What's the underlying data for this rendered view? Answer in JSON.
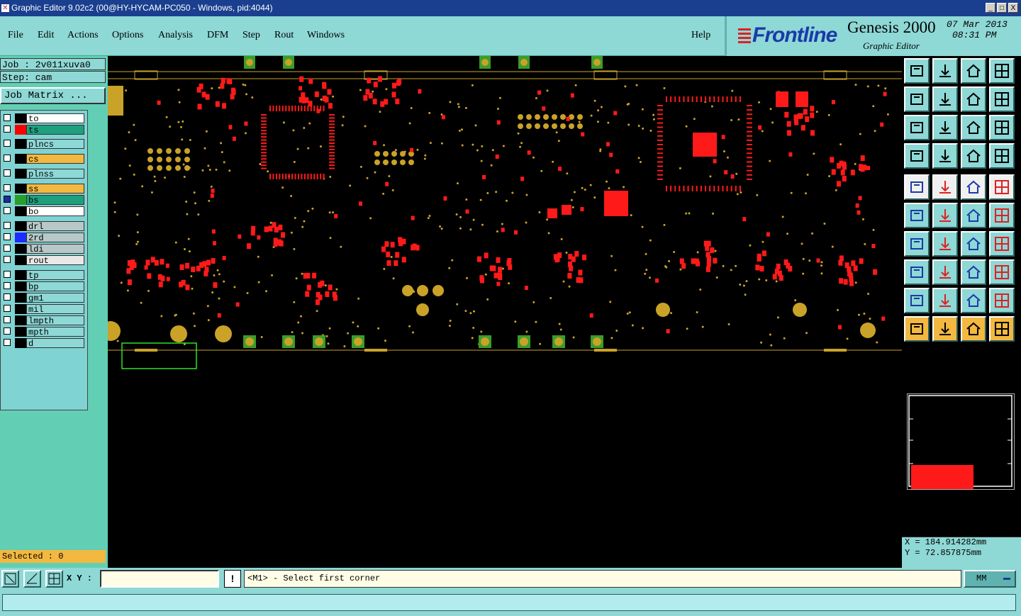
{
  "window": {
    "title": "Graphic Editor 9.02c2 (00@HY-HYCAM-PC050 - Windows, pid:4044)",
    "controls": [
      "_",
      "□",
      "X"
    ]
  },
  "menubar": {
    "items": [
      "File",
      "Edit",
      "Actions",
      "Options",
      "Analysis",
      "DFM",
      "Step",
      "Rout",
      "Windows"
    ],
    "help": "Help"
  },
  "brand": {
    "logo": "Frontline",
    "product": "Genesis 2000",
    "module": "Graphic Editor",
    "date": "07 Mar 2013",
    "time": "08:31 PM"
  },
  "job": {
    "job_line": "Job : 2v011xuva0",
    "step_line": "Step: cam",
    "matrix_button": "Job Matrix ..."
  },
  "layers": [
    {
      "name": "to",
      "color": "#ffffff",
      "swatch": "#000000",
      "selected": false
    },
    {
      "name": "ts",
      "color": "#1ea07d",
      "swatch": "#ff0000",
      "selected": false
    },
    {
      "name": "plncs",
      "color": "#8ed8d6",
      "swatch": "#000000",
      "selected": false
    },
    {
      "name": "cs",
      "color": "#f2b840",
      "swatch": "#000000",
      "selected": false
    },
    {
      "name": "plnss",
      "color": "#8ed8d6",
      "swatch": "#000000",
      "selected": false
    },
    {
      "name": "ss",
      "color": "#f2b840",
      "swatch": "#000000",
      "selected": false
    },
    {
      "name": "bs",
      "color": "#1ea07d",
      "swatch": "#2a9d2a",
      "selected": true
    },
    {
      "name": "bo",
      "color": "#ffffff",
      "swatch": "#000000",
      "selected": false
    },
    {
      "name": "drl",
      "color": "#b8c8c8",
      "swatch": "#000000",
      "selected": false
    },
    {
      "name": "2rd",
      "color": "#b8c8c8",
      "swatch": "#1b2cff",
      "selected": false
    },
    {
      "name": "ldi",
      "color": "#b8c8c8",
      "swatch": "#000000",
      "selected": false
    },
    {
      "name": "rout",
      "color": "#e8e8e8",
      "swatch": "#000000",
      "selected": false
    },
    {
      "name": "tp",
      "color": "#8ed8d6",
      "swatch": "#000000",
      "selected": false
    },
    {
      "name": "bp",
      "color": "#8ed8d6",
      "swatch": "#000000",
      "selected": false
    },
    {
      "name": "gm1",
      "color": "#8ed8d6",
      "swatch": "#000000",
      "selected": false
    },
    {
      "name": "mil",
      "color": "#8ed8d6",
      "swatch": "#000000",
      "selected": false
    },
    {
      "name": "lmpth",
      "color": "#8ed8d6",
      "swatch": "#000000",
      "selected": false
    },
    {
      "name": "mpth",
      "color": "#8ed8d6",
      "swatch": "#000000",
      "selected": false
    },
    {
      "name": "d",
      "color": "#8ed8d6",
      "swatch": "#000000",
      "selected": false
    }
  ],
  "selection": {
    "label": "Selected : 0"
  },
  "coords": {
    "x": "X  =  184.914282mm",
    "y": "Y  =  72.857875mm"
  },
  "status": {
    "xy_label": "X Y :",
    "xy_value": "",
    "warn": "!",
    "prompt": "<M1> - Select first corner",
    "units": "MM"
  },
  "colors": {
    "board_pad": "#ff1a1a",
    "copper": "#c9a227",
    "green_pad": "#3a9d2a",
    "canvas_bg": "#000000",
    "select_box": "#2ee02e"
  }
}
